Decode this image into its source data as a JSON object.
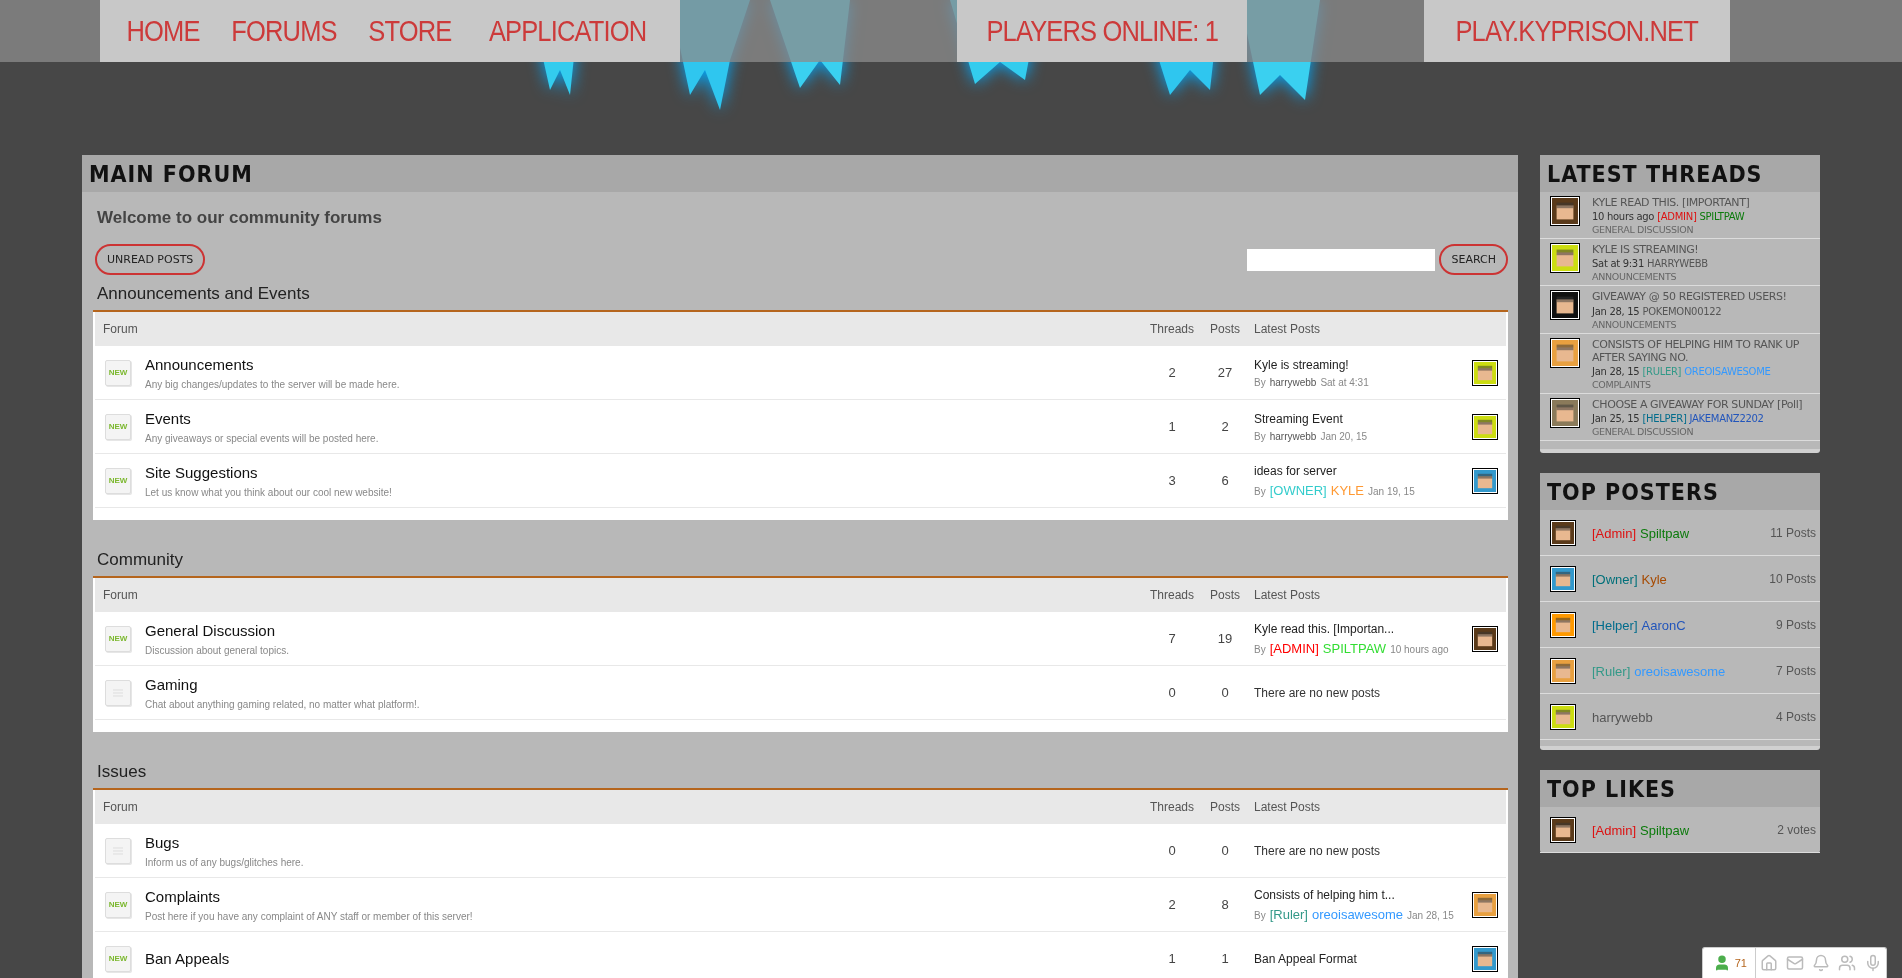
{
  "nav": {
    "links": [
      "HOME",
      "FORUMS",
      "STORE",
      "APPLICATION"
    ],
    "players_online": "PLAYERS ONLINE: 1",
    "server_address": "PLAY.KYPRISON.NET"
  },
  "main_forum": {
    "title": "MAIN FORUM",
    "welcome": "Welcome to our community forums",
    "unread_button": "UNREAD POSTS",
    "search_button": "SEARCH",
    "sections": [
      {
        "title": "Announcements and Events",
        "columns": {
          "forum": "Forum",
          "threads": "Threads",
          "posts": "Posts",
          "latest": "Latest Posts"
        },
        "complete": true,
        "forums": [
          {
            "name": "Announcements",
            "description": "Any big changes/updates to the server will be made here.",
            "unread": true,
            "icon_label": "NEW",
            "threads": "2",
            "posts": "27",
            "latest": {
              "title": "Kyle is streaming!",
              "by": "By",
              "author": [
                {
                  "text": "harrywebb",
                  "color": "#555555"
                }
              ],
              "time": "Sat at 4:31",
              "avatar": {
                "color": "#ccdd11"
              }
            }
          },
          {
            "name": "Events",
            "description": "Any giveaways or special events will be posted here.",
            "unread": true,
            "icon_label": "NEW",
            "threads": "1",
            "posts": "2",
            "latest": {
              "title": "Streaming Event",
              "by": "By",
              "author": [
                {
                  "text": "harrywebb",
                  "color": "#555555"
                }
              ],
              "time": "Jan 20, 15",
              "avatar": {
                "color": "#ccdd11"
              }
            }
          },
          {
            "name": "Site Suggestions",
            "description": "Let us know what you think about our cool new website!",
            "unread": true,
            "icon_label": "NEW",
            "threads": "3",
            "posts": "6",
            "latest": {
              "title": "ideas for server",
              "by": "By",
              "author": [
                {
                  "text": "[OWNER]",
                  "color": "#33cccc"
                },
                {
                  "text": "KYLE",
                  "color": "#ff9933"
                }
              ],
              "time": "Jan 19, 15",
              "avatar": {
                "color": "#3399cc"
              }
            }
          }
        ]
      },
      {
        "title": "Community",
        "columns": {
          "forum": "Forum",
          "threads": "Threads",
          "posts": "Posts",
          "latest": "Latest Posts"
        },
        "complete": true,
        "forums": [
          {
            "name": "General Discussion",
            "description": "Discussion about general topics.",
            "unread": true,
            "icon_label": "NEW",
            "threads": "7",
            "posts": "19",
            "latest": {
              "title": "Kyle read this. [Importan...",
              "by": "By",
              "author": [
                {
                  "text": "[ADMIN]",
                  "color": "#ff0000"
                },
                {
                  "text": "SPILTPAW",
                  "color": "#33dd33"
                }
              ],
              "time": "10 hours ago",
              "avatar": {
                "color": "#5a3a1a"
              }
            }
          },
          {
            "name": "Gaming",
            "description": "Chat about anything gaming related, no matter what platform!.",
            "unread": false,
            "threads": "0",
            "posts": "0",
            "empty_text": "There are no new posts"
          }
        ]
      },
      {
        "title": "Issues",
        "columns": {
          "forum": "Forum",
          "threads": "Threads",
          "posts": "Posts",
          "latest": "Latest Posts"
        },
        "complete": false,
        "forums": [
          {
            "name": "Bugs",
            "description": "Inform us of any bugs/glitches here.",
            "unread": false,
            "threads": "0",
            "posts": "0",
            "empty_text": "There are no new posts"
          },
          {
            "name": "Complaints",
            "description": "Post here if you have any complaint of ANY staff or member of this server!",
            "unread": true,
            "icon_label": "NEW",
            "threads": "2",
            "posts": "8",
            "latest": {
              "title": "Consists of helping him t...",
              "by": "By",
              "author": [
                {
                  "text": "[Ruler]",
                  "color": "#339988"
                },
                {
                  "text": "oreoisawesome",
                  "color": "#3399ff"
                }
              ],
              "time": "Jan 28, 15",
              "avatar": {
                "color": "#e8a040"
              }
            }
          },
          {
            "name": "Ban Appeals",
            "unread": true,
            "icon_label": "NEW",
            "threads": "1",
            "posts": "1",
            "latest": {
              "title": "Ban Appeal Format",
              "avatar": {
                "color": "#3399cc"
              }
            }
          }
        ]
      }
    ]
  },
  "sidebar": {
    "latest_threads": {
      "title": "LATEST THREADS",
      "items": [
        {
          "title": "KYLE READ THIS. [IMPORTANT]",
          "time": "10 hours ago",
          "author": [
            {
              "text": "[ADMIN]",
              "color": "#dd1111"
            },
            {
              "text": "SPILTPAW",
              "color": "#0b7a0b"
            }
          ],
          "forum": "GENERAL DISCUSSION",
          "avatar": {
            "color": "#5a3a1a"
          }
        },
        {
          "title": "KYLE IS STREAMING!",
          "time": "Sat at 9:31",
          "author": [
            {
              "text": "HARRYWEBB",
              "color": "#555555"
            }
          ],
          "forum": "ANNOUNCEMENTS",
          "avatar": {
            "color": "#ccdd11"
          }
        },
        {
          "title": "GIVEAWAY @ 50 REGISTERED USERS!",
          "time": "Jan 28, 15",
          "author": [
            {
              "text": "POKEMON00122",
              "color": "#555555"
            }
          ],
          "forum": "ANNOUNCEMENTS",
          "avatar": {
            "color": "#111111"
          }
        },
        {
          "title": "CONSISTS OF HELPING HIM TO RANK UP AFTER SAYING NO.",
          "time": "Jan 28, 15",
          "author": [
            {
              "text": "[RULER]",
              "color": "#339988"
            },
            {
              "text": "OREOISAWESOME",
              "color": "#3399ff"
            }
          ],
          "forum": "COMPLAINTS",
          "avatar": {
            "color": "#e8a040"
          }
        },
        {
          "title": "CHOOSE A GIVEAWAY FOR SUNDAY [Poll]",
          "time": "Jan 25, 15",
          "author": [
            {
              "text": "[HELPER]",
              "color": "#006c8c"
            },
            {
              "text": "JAKEMANZ2202",
              "color": "#2255bb"
            }
          ],
          "forum": "GENERAL DISCUSSION",
          "avatar": {
            "color": "#8a7a5a"
          }
        }
      ]
    },
    "top_posters": {
      "title": "TOP POSTERS",
      "items": [
        {
          "author": [
            {
              "text": "[Admin]",
              "color": "#dd1111"
            },
            {
              "text": "Spiltpaw",
              "color": "#0b7a0b"
            }
          ],
          "count": "11 Posts",
          "avatar": {
            "color": "#5a3a1a"
          }
        },
        {
          "author": [
            {
              "text": "[Owner]",
              "color": "#00707a"
            },
            {
              "text": "Kyle",
              "color": "#a64a00"
            }
          ],
          "count": "10 Posts",
          "avatar": {
            "color": "#3399cc"
          }
        },
        {
          "author": [
            {
              "text": "[Helper]",
              "color": "#006c8c"
            },
            {
              "text": "AaronC",
              "color": "#2255bb"
            }
          ],
          "count": "9 Posts",
          "avatar": {
            "color": "#ff9900"
          }
        },
        {
          "author": [
            {
              "text": "[Ruler]",
              "color": "#339988"
            },
            {
              "text": "oreoisawesome",
              "color": "#3399ff"
            }
          ],
          "count": "7 Posts",
          "avatar": {
            "color": "#e8a040"
          }
        },
        {
          "author": [
            {
              "text": "harrywebb",
              "color": "#555555"
            }
          ],
          "count": "4 Posts",
          "avatar": {
            "color": "#ccdd11"
          }
        }
      ]
    },
    "top_likes": {
      "title": "TOP LIKES",
      "items": [
        {
          "author": [
            {
              "text": "[Admin]",
              "color": "#dd1111"
            },
            {
              "text": "Spiltpaw",
              "color": "#0b7a0b"
            }
          ],
          "count": "2 votes",
          "avatar": {
            "color": "#5a3a1a"
          }
        }
      ]
    }
  },
  "bottom_bar": {
    "online_count": "71"
  }
}
